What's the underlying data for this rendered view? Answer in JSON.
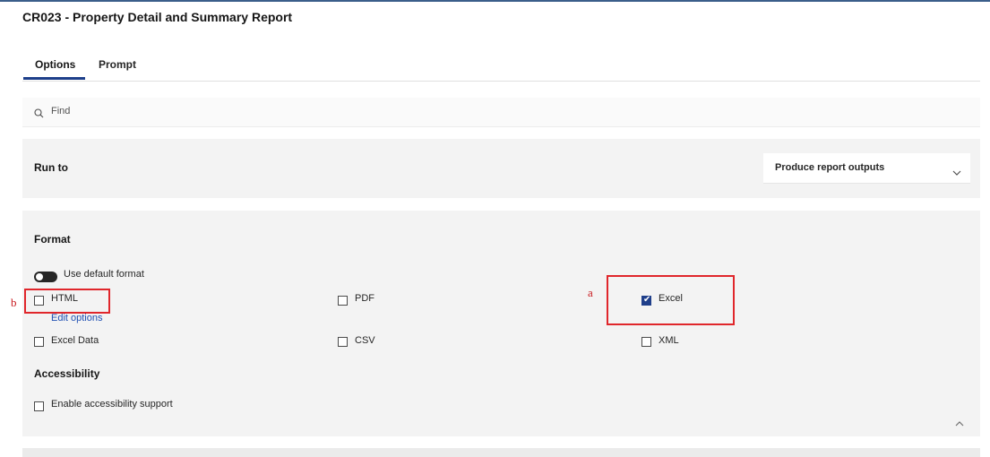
{
  "title": "CR023 - Property Detail and Summary Report",
  "tabs": [
    {
      "label": "Options",
      "active": true
    },
    {
      "label": "Prompt",
      "active": false
    }
  ],
  "search": {
    "placeholder": "Find",
    "icon": "search-icon"
  },
  "run_to": {
    "label": "Run to",
    "selected": "Produce report outputs"
  },
  "format": {
    "label": "Format",
    "toggle_label": "Use default format",
    "options": [
      {
        "label": "HTML",
        "checked": false
      },
      {
        "label": "PDF",
        "checked": false
      },
      {
        "label": "Excel",
        "checked": true
      },
      {
        "label": "Excel Data",
        "checked": false
      },
      {
        "label": "CSV",
        "checked": false
      },
      {
        "label": "XML",
        "checked": false
      }
    ],
    "edit_options": "Edit options"
  },
  "accessibility": {
    "label": "Accessibility",
    "option": "Enable accessibility support",
    "checked": false
  },
  "annotations": {
    "a": "a",
    "b": "b"
  },
  "colors": {
    "accent": "#1f3f8a",
    "annotation": "#e0262b",
    "panel": "#f3f3f3"
  }
}
